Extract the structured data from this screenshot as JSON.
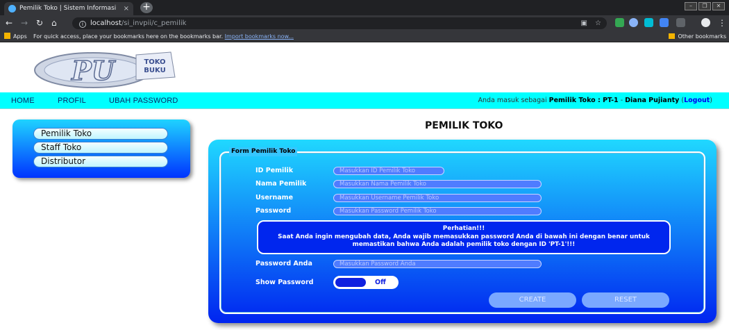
{
  "browser": {
    "tab_title": "Pemilik Toko | Sistem Informasi",
    "tab_close": "×",
    "new_tab": "+",
    "url_host": "localhost",
    "url_path": "/si_invpii/c_pemilik",
    "bookmarks_apps": "Apps",
    "bookmarks_hint": "For quick access, place your bookmarks here on the bookmarks bar.",
    "bookmarks_import": "Import bookmarks now...",
    "bookmarks_other": "Other bookmarks"
  },
  "logo": {
    "big": "PU",
    "line1": "TOKO",
    "line2": "BUKU"
  },
  "menu": {
    "items": [
      "HOME",
      "PROFIL",
      "UBAH PASSWORD"
    ],
    "user_prefix": "Anda masuk sebagai ",
    "user_role": "Pemilik Toko : PT-1",
    "user_sep": " - ",
    "user_name": "Diana Pujianty",
    "logout_open": " (",
    "logout": "Logout",
    "logout_close": ")"
  },
  "sidebar": {
    "items": [
      "Pemilik Toko",
      "Staff Toko",
      "Distributor"
    ]
  },
  "content": {
    "title": "PEMILIK TOKO",
    "legend": "Form Pemilik Toko",
    "fields": [
      {
        "label": "ID Pemilik",
        "placeholder": "Masukkan ID Pemilik Toko"
      },
      {
        "label": "Nama Pemilik",
        "placeholder": "Masukkan Nama Pemilik Toko"
      },
      {
        "label": "Username",
        "placeholder": "Masukkan Username Pemilik Toko"
      },
      {
        "label": "Password",
        "placeholder": "Masukkan Password Pemilik Toko"
      }
    ],
    "notice": {
      "title": "Perhatian!!!",
      "line1": "Saat Anda ingin mengubah data, Anda wajib memasukkan password Anda di bawah ini dengan benar untuk",
      "line2": "memastikan bahwa Anda adalah pemilik toko dengan ID 'PT-1'!!!"
    },
    "confirm_password": {
      "label": "Password Anda",
      "placeholder": "Masukkan Password Anda"
    },
    "show_password": {
      "label": "Show Password",
      "state": "Off"
    },
    "buttons": {
      "create": "CREATE",
      "reset": "RESET"
    }
  },
  "colors": {
    "menu_bg": "#00ffff",
    "panel_top": "#20d8ff",
    "panel_bottom": "#0024f0"
  }
}
